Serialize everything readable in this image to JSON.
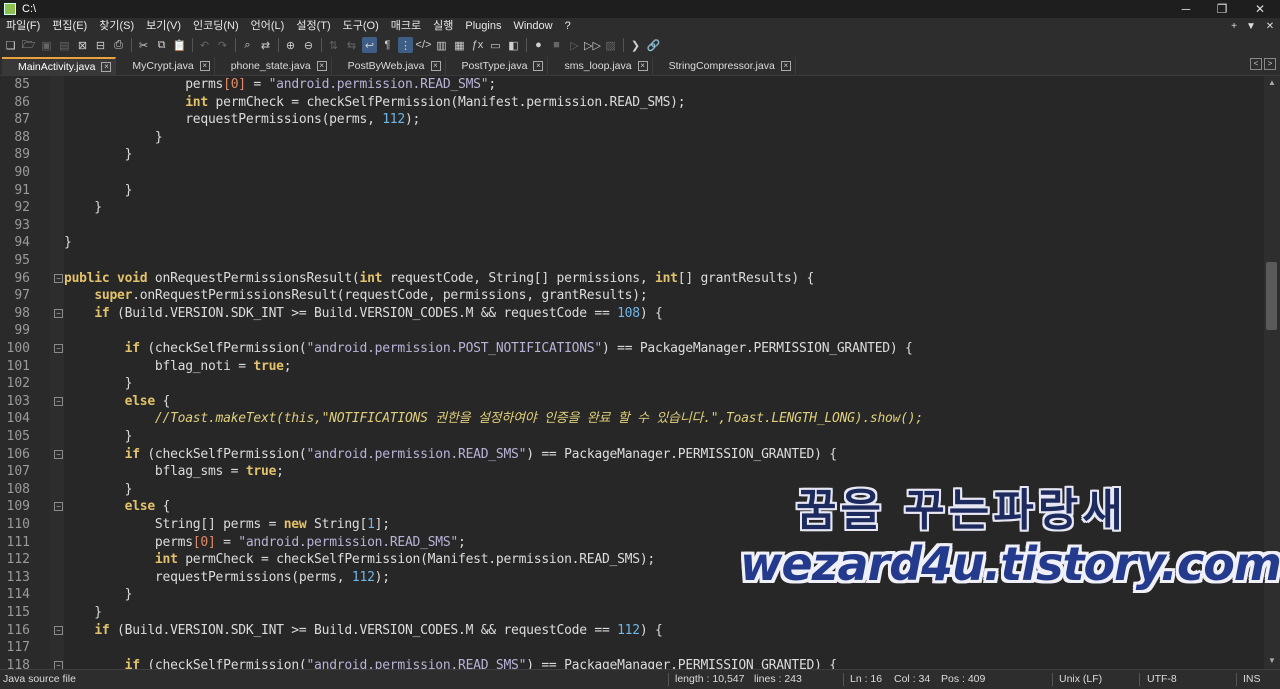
{
  "window": {
    "title": "C:\\",
    "controls": [
      "─",
      "❐",
      "✕"
    ]
  },
  "menu": {
    "items": [
      "파일(F)",
      "편집(E)",
      "찾기(S)",
      "보기(V)",
      "인코딩(N)",
      "언어(L)",
      "설정(T)",
      "도구(O)",
      "매크로",
      "실행",
      "Plugins",
      "Window",
      "?"
    ],
    "right_controls": [
      "+",
      "▼",
      "✕"
    ]
  },
  "toolbar": {
    "icons": [
      "new-file-icon",
      "open-file-icon",
      "save-icon",
      "save-all-icon",
      "close-icon",
      "close-all-icon",
      "print-icon",
      "|",
      "cut-icon",
      "copy-icon",
      "paste-icon",
      "|",
      "undo-icon",
      "redo-icon",
      "|",
      "find-icon",
      "replace-icon",
      "|",
      "zoom-in-icon",
      "zoom-out-icon",
      "|",
      "sync-vertical-icon",
      "sync-horizontal-icon",
      "word-wrap-icon",
      "show-all-chars-icon",
      "indent-guide-icon",
      "xml-tag-icon",
      "doc-map-icon",
      "folder-workspace-icon",
      "function-list-icon",
      "monitoring-icon",
      "document-list-icon",
      "|",
      "record-macro-icon",
      "stop-record-icon",
      "play-macro-icon",
      "run-macro-multiple-icon",
      "save-macro-icon",
      "|",
      "terminal-icon",
      "link-icon"
    ],
    "glyphs": {
      "new-file-icon": "❏",
      "open-file-icon": "🗁",
      "save-icon": "▣",
      "save-all-icon": "▤",
      "close-icon": "⊠",
      "close-all-icon": "⊟",
      "print-icon": "⎙",
      "cut-icon": "✂",
      "copy-icon": "⧉",
      "paste-icon": "📋",
      "undo-icon": "↶",
      "redo-icon": "↷",
      "find-icon": "⌕",
      "replace-icon": "⇄",
      "zoom-in-icon": "⊕",
      "zoom-out-icon": "⊖",
      "sync-vertical-icon": "⇅",
      "sync-horizontal-icon": "⇆",
      "word-wrap-icon": "↩",
      "show-all-chars-icon": "¶",
      "indent-guide-icon": "⋮",
      "xml-tag-icon": "</>",
      "doc-map-icon": "▥",
      "folder-workspace-icon": "▦",
      "function-list-icon": "ƒx",
      "monitoring-icon": "▭",
      "document-list-icon": "◧",
      "record-macro-icon": "●",
      "stop-record-icon": "■",
      "play-macro-icon": "▷",
      "run-macro-multiple-icon": "▷▷",
      "save-macro-icon": "▨",
      "terminal-icon": "❯",
      "link-icon": "🔗"
    },
    "dim": [
      "save-icon",
      "save-all-icon",
      "undo-icon",
      "redo-icon",
      "sync-vertical-icon",
      "sync-horizontal-icon",
      "stop-record-icon",
      "play-macro-icon",
      "save-macro-icon"
    ],
    "active": [
      "word-wrap-icon",
      "indent-guide-icon"
    ]
  },
  "tabs": [
    {
      "label": "MainActivity.java",
      "active": true
    },
    {
      "label": "MyCrypt.java",
      "active": false
    },
    {
      "label": "phone_state.java",
      "active": false
    },
    {
      "label": "PostByWeb.java",
      "active": false
    },
    {
      "label": "PostType.java",
      "active": false
    },
    {
      "label": "sms_loop.java",
      "active": false
    },
    {
      "label": "StringCompressor.java",
      "active": false
    }
  ],
  "tab_close_glyph": "×",
  "tab_nav": [
    "<",
    ">",
    "×"
  ],
  "editor": {
    "lines": [
      {
        "n": "85",
        "fold": "",
        "tokens": [
          [
            "",
            "                perms"
          ],
          [
            "idx",
            "[0]"
          ],
          [
            "",
            " = "
          ],
          [
            "str",
            "\"android.permission.READ_SMS\""
          ],
          [
            "",
            ";"
          ]
        ]
      },
      {
        "n": "86",
        "fold": "",
        "tokens": [
          [
            "",
            "                "
          ],
          [
            "kw",
            "int"
          ],
          [
            "",
            " permCheck = checkSelfPermission(Manifest.permission.READ_SMS);"
          ]
        ]
      },
      {
        "n": "87",
        "fold": "",
        "tokens": [
          [
            "",
            "                requestPermissions(perms, "
          ],
          [
            "num",
            "112"
          ],
          [
            "",
            ");"
          ]
        ]
      },
      {
        "n": "88",
        "fold": "",
        "tokens": [
          [
            "",
            "            }"
          ]
        ]
      },
      {
        "n": "89",
        "fold": "",
        "tokens": [
          [
            "",
            "        }"
          ]
        ]
      },
      {
        "n": "90",
        "fold": "",
        "tokens": [
          [
            "",
            ""
          ]
        ]
      },
      {
        "n": "91",
        "fold": "",
        "tokens": [
          [
            "",
            "        }"
          ]
        ]
      },
      {
        "n": "92",
        "fold": "",
        "tokens": [
          [
            "",
            "    }"
          ]
        ]
      },
      {
        "n": "93",
        "fold": "",
        "tokens": [
          [
            "",
            ""
          ]
        ]
      },
      {
        "n": "94",
        "fold": "",
        "tokens": [
          [
            "",
            "}"
          ]
        ]
      },
      {
        "n": "95",
        "fold": "",
        "tokens": [
          [
            "",
            ""
          ]
        ]
      },
      {
        "n": "96",
        "fold": "−",
        "tokens": [
          [
            "kw",
            "public"
          ],
          [
            "",
            " "
          ],
          [
            "kw",
            "void"
          ],
          [
            "",
            " onRequestPermissionsResult("
          ],
          [
            "kw",
            "int"
          ],
          [
            "",
            " requestCode, String[] permissions, "
          ],
          [
            "kw",
            "int"
          ],
          [
            "",
            "[] grantResults) {"
          ]
        ]
      },
      {
        "n": "97",
        "fold": "",
        "tokens": [
          [
            "",
            "    "
          ],
          [
            "kw",
            "super"
          ],
          [
            "",
            ".onRequestPermissionsResult(requestCode, permissions, grantResults);"
          ]
        ]
      },
      {
        "n": "98",
        "fold": "−",
        "tokens": [
          [
            "",
            "    "
          ],
          [
            "kw",
            "if"
          ],
          [
            "",
            " (Build.VERSION.SDK_INT >= Build.VERSION_CODES.M && requestCode == "
          ],
          [
            "num",
            "108"
          ],
          [
            "",
            ") {"
          ]
        ]
      },
      {
        "n": "99",
        "fold": "",
        "tokens": [
          [
            "",
            ""
          ]
        ]
      },
      {
        "n": "100",
        "fold": "−",
        "tokens": [
          [
            "",
            "        "
          ],
          [
            "kw",
            "if"
          ],
          [
            "",
            " (checkSelfPermission("
          ],
          [
            "str",
            "\"android.permission.POST_NOTIFICATIONS\""
          ],
          [
            "",
            ") == PackageManager.PERMISSION_GRANTED) {"
          ]
        ]
      },
      {
        "n": "101",
        "fold": "",
        "tokens": [
          [
            "",
            "            bflag_noti = "
          ],
          [
            "kw",
            "true"
          ],
          [
            "",
            ";"
          ]
        ]
      },
      {
        "n": "102",
        "fold": "",
        "tokens": [
          [
            "",
            "        }"
          ]
        ]
      },
      {
        "n": "103",
        "fold": "−",
        "tokens": [
          [
            "",
            "        "
          ],
          [
            "kw",
            "else"
          ],
          [
            "",
            " {"
          ]
        ]
      },
      {
        "n": "104",
        "fold": "",
        "tokens": [
          [
            "",
            "            "
          ],
          [
            "cmt",
            "//Toast.makeText(this,\"NOTIFICATIONS 권한을 설정하여야 인증을 완료 할 수 있습니다.\",Toast.LENGTH_LONG).show();"
          ]
        ]
      },
      {
        "n": "105",
        "fold": "",
        "tokens": [
          [
            "",
            "        }"
          ]
        ]
      },
      {
        "n": "106",
        "fold": "−",
        "tokens": [
          [
            "",
            "        "
          ],
          [
            "kw",
            "if"
          ],
          [
            "",
            " (checkSelfPermission("
          ],
          [
            "str",
            "\"android.permission.READ_SMS\""
          ],
          [
            "",
            ") == PackageManager.PERMISSION_GRANTED) {"
          ]
        ]
      },
      {
        "n": "107",
        "fold": "",
        "tokens": [
          [
            "",
            "            bflag_sms = "
          ],
          [
            "kw",
            "true"
          ],
          [
            "",
            ";"
          ]
        ]
      },
      {
        "n": "108",
        "fold": "",
        "tokens": [
          [
            "",
            "        }"
          ]
        ]
      },
      {
        "n": "109",
        "fold": "−",
        "tokens": [
          [
            "",
            "        "
          ],
          [
            "kw",
            "else"
          ],
          [
            "",
            " {"
          ]
        ]
      },
      {
        "n": "110",
        "fold": "",
        "tokens": [
          [
            "",
            "            String[] perms = "
          ],
          [
            "kw",
            "new"
          ],
          [
            "",
            " String["
          ],
          [
            "num",
            "1"
          ],
          [
            "",
            "];"
          ]
        ]
      },
      {
        "n": "111",
        "fold": "",
        "tokens": [
          [
            "",
            "            perms"
          ],
          [
            "idx",
            "[0]"
          ],
          [
            "",
            " = "
          ],
          [
            "str",
            "\"android.permission.READ_SMS\""
          ],
          [
            "",
            ";"
          ]
        ]
      },
      {
        "n": "112",
        "fold": "",
        "tokens": [
          [
            "",
            "            "
          ],
          [
            "kw",
            "int"
          ],
          [
            "",
            " permCheck = checkSelfPermission(Manifest.permission.READ_SMS);"
          ]
        ]
      },
      {
        "n": "113",
        "fold": "",
        "tokens": [
          [
            "",
            "            requestPermissions(perms, "
          ],
          [
            "num",
            "112"
          ],
          [
            "",
            ");"
          ]
        ]
      },
      {
        "n": "114",
        "fold": "",
        "tokens": [
          [
            "",
            "        }"
          ]
        ]
      },
      {
        "n": "115",
        "fold": "",
        "tokens": [
          [
            "",
            "    }"
          ]
        ]
      },
      {
        "n": "116",
        "fold": "−",
        "tokens": [
          [
            "",
            "    "
          ],
          [
            "kw",
            "if"
          ],
          [
            "",
            " (Build.VERSION.SDK_INT >= Build.VERSION_CODES.M && requestCode == "
          ],
          [
            "num",
            "112"
          ],
          [
            "",
            ") {"
          ]
        ]
      },
      {
        "n": "117",
        "fold": "",
        "tokens": [
          [
            "",
            ""
          ]
        ]
      },
      {
        "n": "118",
        "fold": "−",
        "tokens": [
          [
            "",
            "        "
          ],
          [
            "kw",
            "if"
          ],
          [
            "",
            " (checkSelfPermission("
          ],
          [
            "str",
            "\"android.permission.READ_SMS\""
          ],
          [
            "",
            ") == PackageManager.PERMISSION_GRANTED) {"
          ]
        ]
      }
    ]
  },
  "scrollbar": {
    "up": "▲",
    "down": "▼"
  },
  "watermark": {
    "line1": "꿈을 꾸는파랑새",
    "line2": "wezard4u.tistory.com"
  },
  "statusbar": {
    "filetype": "Java source file",
    "length": "length : 10,547",
    "lines": "lines : 243",
    "ln": "Ln : 16",
    "col": "Col : 34",
    "pos": "Pos : 409",
    "eol": "Unix (LF)",
    "encoding": "UTF-8",
    "mode": "INS"
  },
  "colors": {
    "keyword": "#e2c26a",
    "string": "#b9b2d6",
    "number": "#6fb6e6",
    "comment": "#dfcf7a",
    "active_tab_accent": "#e8a33d"
  }
}
